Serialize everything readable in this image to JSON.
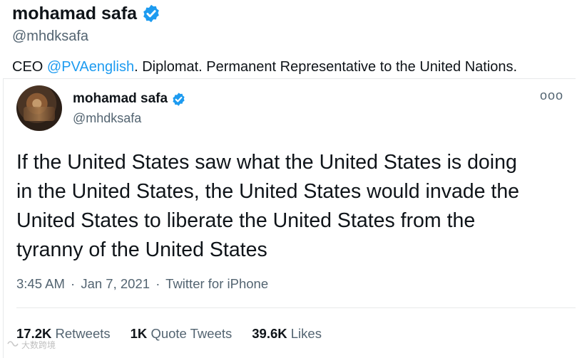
{
  "profile": {
    "display_name": "mohamad safa",
    "handle": "@mhdksafa",
    "bio_prefix": "CEO ",
    "bio_mention": "@PVAenglish",
    "bio_suffix": ". Diplomat. Permanent Representative to the United Nations."
  },
  "tweet": {
    "display_name": "mohamad safa",
    "handle": "@mhdksafa",
    "more_glyph": "ooo",
    "text": "If the United States saw what the United States is doing\nin the United States, the United States would invade the\nUnited States to liberate the United States from the\ntyranny of the United States",
    "time": "3:45 AM",
    "date": "Jan 7, 2021",
    "source": "Twitter for iPhone",
    "separator": "·",
    "stats": {
      "retweets_count": "17.2K",
      "retweets_label": "Retweets",
      "quotes_count": "1K",
      "quotes_label": "Quote Tweets",
      "likes_count": "39.6K",
      "likes_label": "Likes"
    }
  },
  "watermark": {
    "text": "大数跨境"
  },
  "colors": {
    "accent": "#1d9bf0",
    "muted": "#536471",
    "text": "#0f1419"
  }
}
